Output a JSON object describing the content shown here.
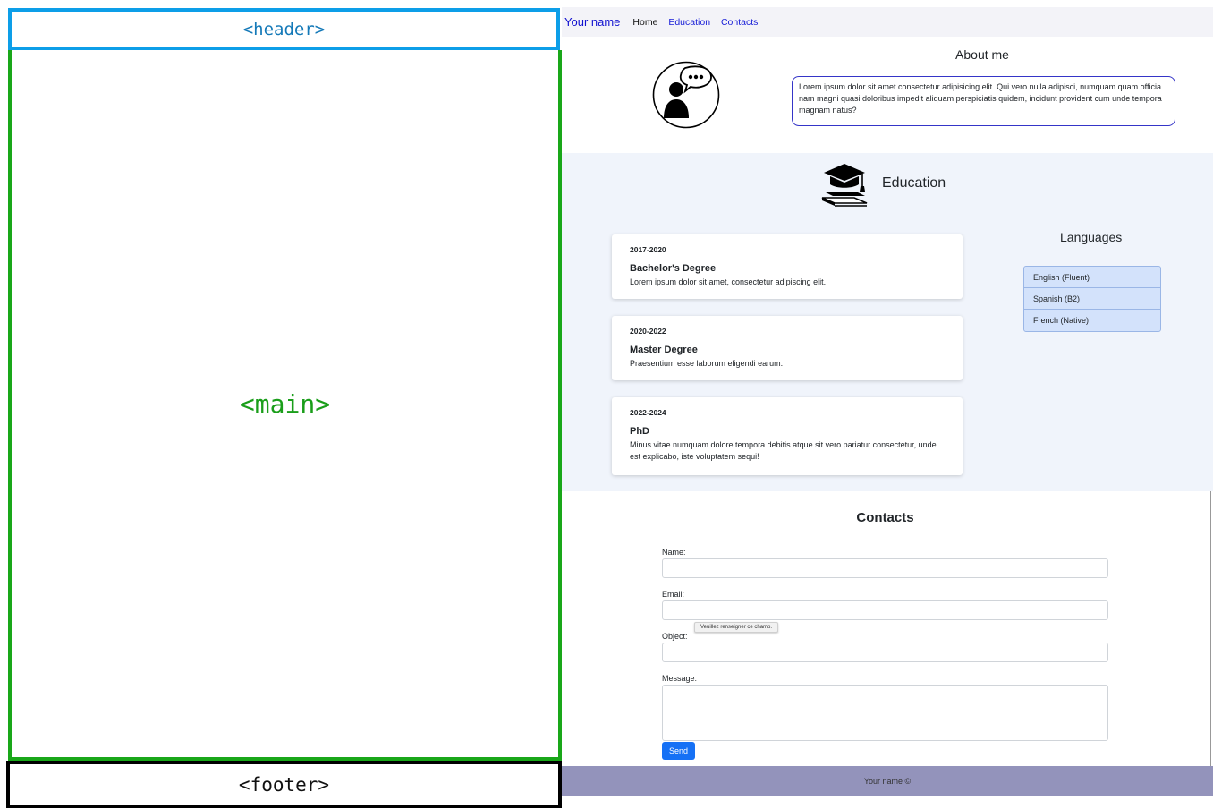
{
  "wireframe": {
    "header_label": "<header>",
    "main_label": "<main>",
    "footer_label": "<footer>"
  },
  "nav": {
    "brand": "Your name",
    "links": [
      "Home",
      "Education",
      "Contacts"
    ]
  },
  "about": {
    "title": "About me",
    "text": "Lorem ipsum dolor sit amet consectetur adipisicing elit. Qui vero nulla adipisci, numquam quam officia nam magni quasi doloribus impedit aliquam perspiciatis quidem, incidunt provident cum unde tempora magnam natus?"
  },
  "education": {
    "title": "Education",
    "items": [
      {
        "years": "2017-2020",
        "degree": "Bachelor's Degree",
        "desc": "Lorem ipsum dolor sit amet, consectetur adipiscing elit."
      },
      {
        "years": "2020-2022",
        "degree": "Master Degree",
        "desc": "Praesentium esse laborum eligendi earum."
      },
      {
        "years": "2022-2024",
        "degree": "PhD",
        "desc": "Minus vitae numquam dolore tempora debitis atque sit vero pariatur consectetur, unde est explicabo, iste voluptatem sequi!"
      }
    ]
  },
  "languages": {
    "title": "Languages",
    "items": [
      "English (Fluent)",
      "Spanish (B2)",
      "French (Native)"
    ]
  },
  "contacts": {
    "title": "Contacts",
    "name_label": "Name:",
    "email_label": "Email:",
    "object_label": "Object:",
    "message_label": "Message:",
    "tooltip": "Veuillez renseigner ce champ.",
    "send_label": "Send"
  },
  "footer": {
    "text": "Your name ©"
  },
  "colors": {
    "header_outline": "#0d9ee8",
    "main_outline": "#19a719",
    "footer_bg": "#9393bb",
    "send_button": "#1671f5"
  }
}
